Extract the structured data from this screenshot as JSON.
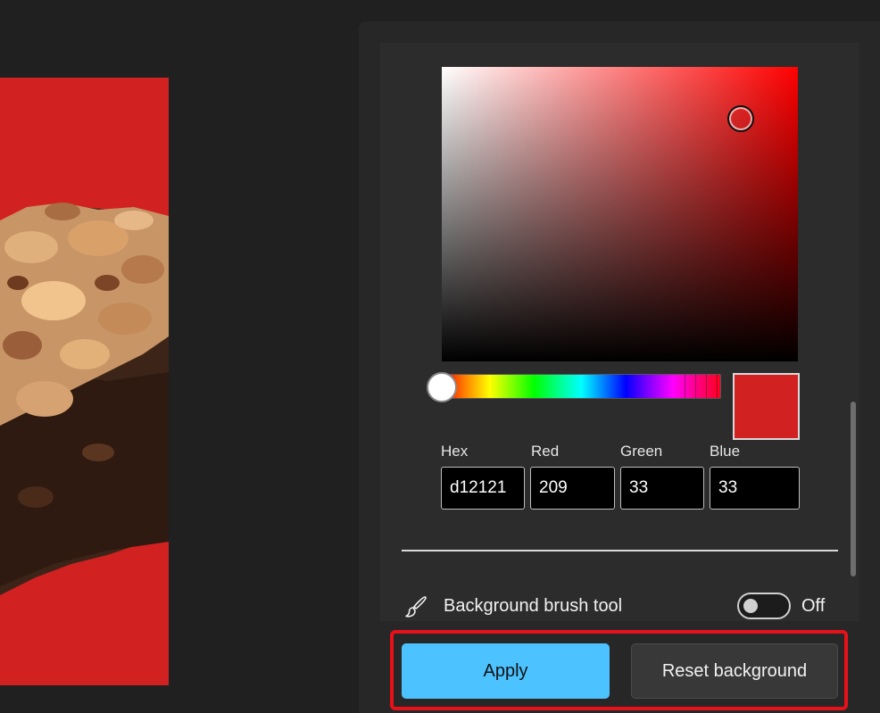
{
  "canvas": {
    "background_color": "#d12121",
    "image_subject": "brownie-icon"
  },
  "color_picker": {
    "selected_color": "#d12121",
    "hue_color": "#ff0000",
    "fields": [
      {
        "label": "Hex",
        "value": "d12121"
      },
      {
        "label": "Red",
        "value": "209"
      },
      {
        "label": "Green",
        "value": "33"
      },
      {
        "label": "Blue",
        "value": "33"
      }
    ]
  },
  "brush_tool": {
    "label": "Background brush tool",
    "state_label": "Off",
    "enabled": false,
    "icon": "paintbrush-icon"
  },
  "actions": {
    "apply_label": "Apply",
    "reset_label": "Reset background",
    "accent_color": "#4cc2ff",
    "highlight_color": "#e8111a"
  }
}
